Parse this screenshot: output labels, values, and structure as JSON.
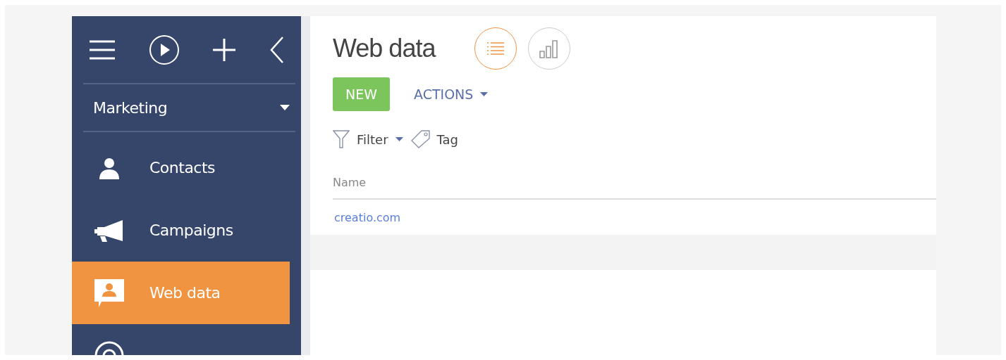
{
  "sidebar": {
    "section": "Marketing",
    "items": [
      {
        "label": "Contacts",
        "kind": "person",
        "selected": false
      },
      {
        "label": "Campaigns",
        "kind": "megaphone",
        "selected": false
      },
      {
        "label": "Web data",
        "kind": "chat",
        "selected": true
      },
      {
        "kind": "at",
        "selected": false
      }
    ]
  },
  "page": {
    "title": "Web data",
    "views": [
      {
        "kind": "list",
        "selected": true
      },
      {
        "kind": "chart",
        "selected": false
      }
    ],
    "new_button": "NEW",
    "actions_button": "ACTIONS",
    "filter": "Filter",
    "tag": "Tag"
  },
  "table": {
    "columns": [
      "Name"
    ],
    "rows": [
      [
        "creatio.com"
      ]
    ]
  }
}
